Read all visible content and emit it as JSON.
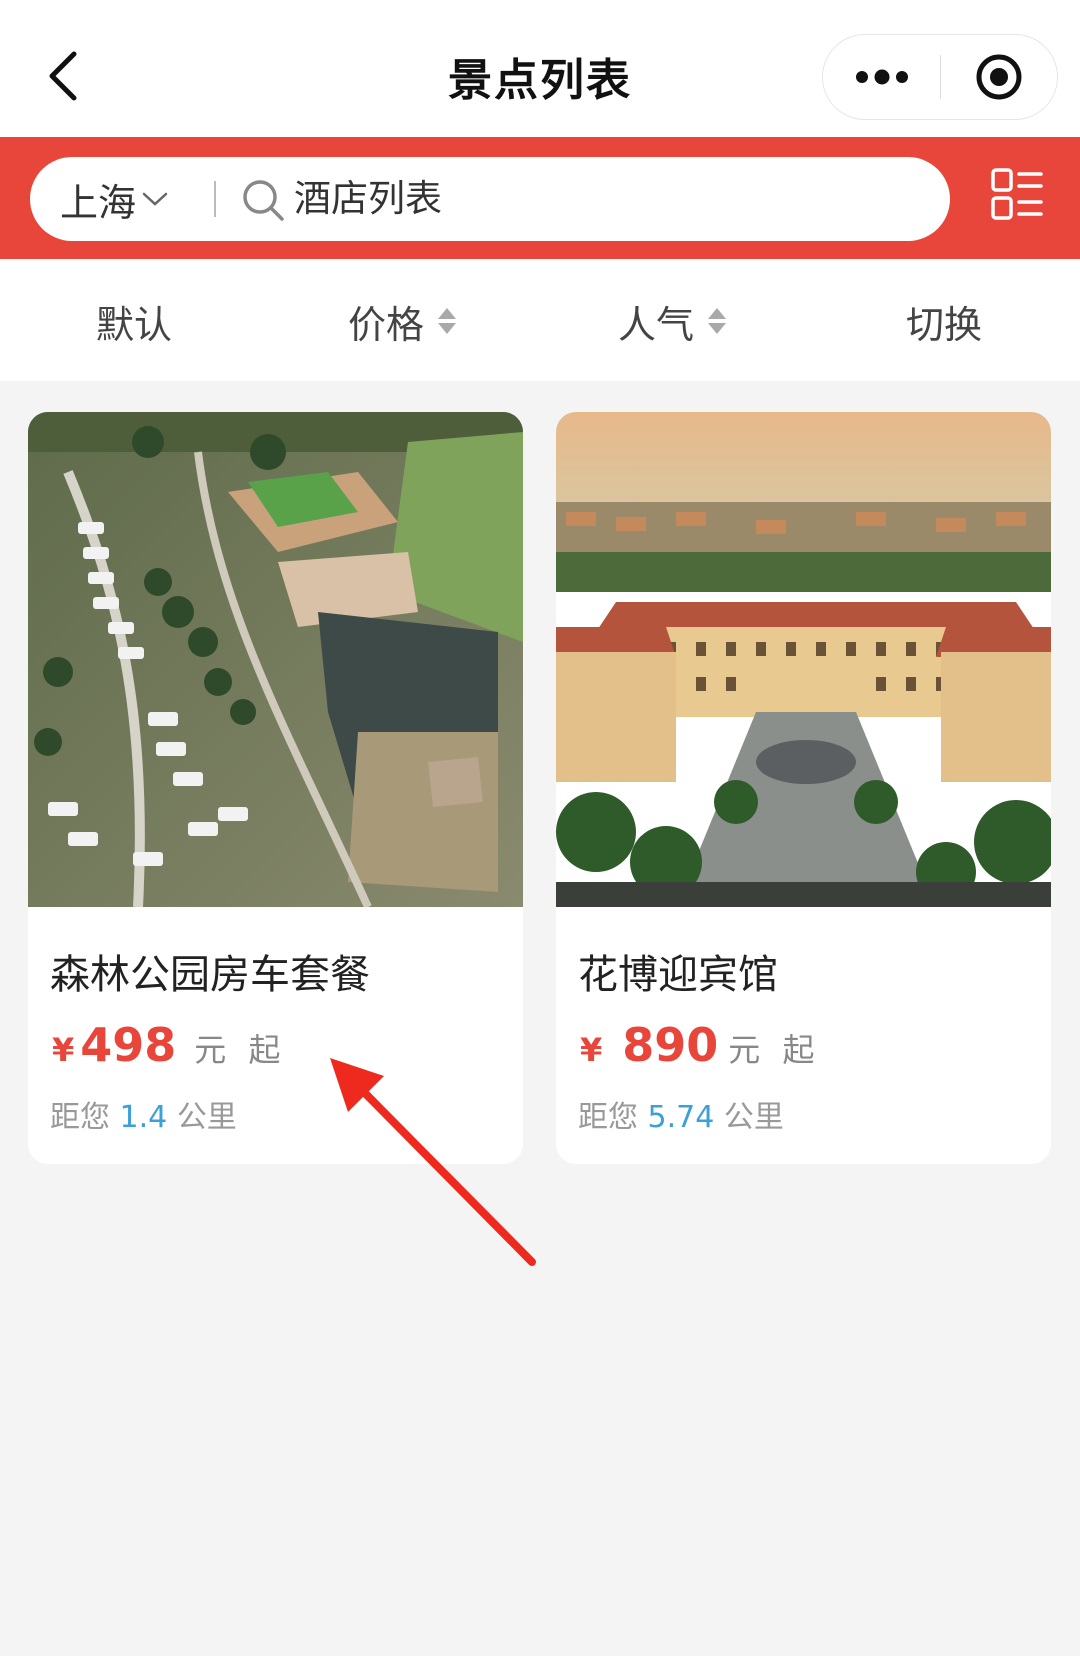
{
  "nav": {
    "title": "景点列表"
  },
  "search": {
    "city": "上海",
    "placeholder": "酒店列表"
  },
  "sort": {
    "items": [
      "默认",
      "价格",
      "人气",
      "切换"
    ]
  },
  "cards": [
    {
      "title": "森林公园房车套餐",
      "currency": "¥",
      "price": "498",
      "unit": "元 起",
      "distance_prefix": "距您",
      "distance": "1.4",
      "distance_unit": "公里"
    },
    {
      "title": "花博迎宾馆",
      "currency": "¥",
      "price": "890",
      "unit": "元 起",
      "distance_prefix": "距您",
      "distance": "5.74",
      "distance_unit": "公里"
    }
  ],
  "colors": {
    "brand_red": "#e8463a",
    "distance_blue": "#3aa1d8",
    "annotation_red": "#ee2a1e"
  },
  "icons": [
    "back-chevron-icon",
    "more-dots-icon",
    "target-circle-icon",
    "chevron-down-icon",
    "search-icon",
    "list-layout-icon",
    "sort-arrows-icon",
    "annotation-arrow"
  ]
}
